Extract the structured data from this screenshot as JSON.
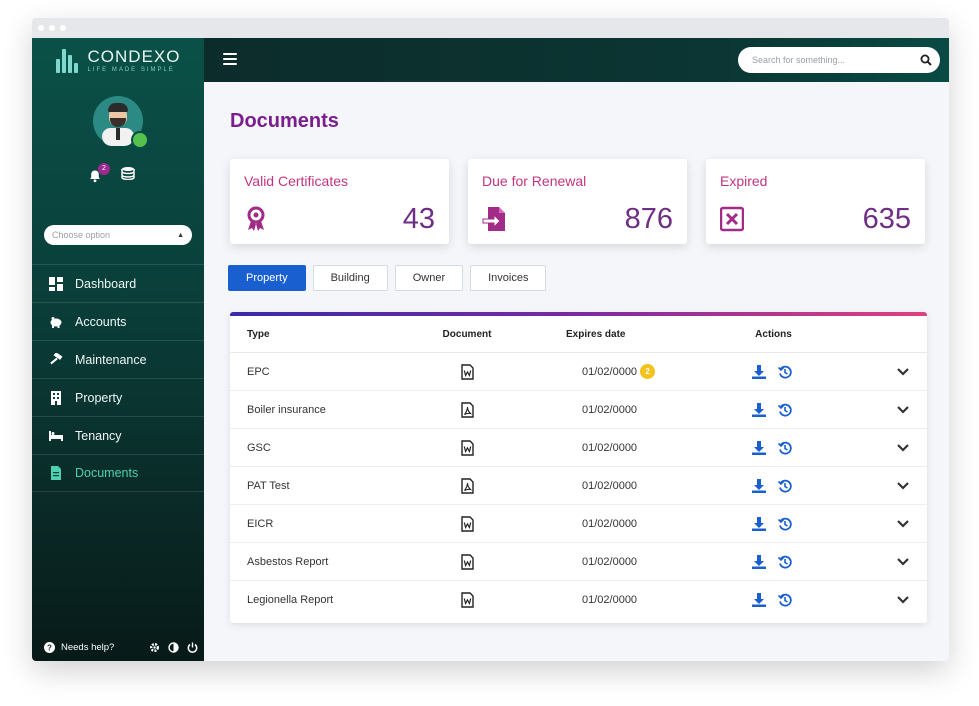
{
  "brand": {
    "name": "CONDEXO",
    "tagline": "LIFE MADE SIMPLE",
    "accent": "#7a1e8e",
    "card_label_color": "#c3347f",
    "active_tab_color": "#1a5fd0",
    "active_nav_color": "#4fd0b0"
  },
  "sidebar": {
    "notification_count": "2",
    "choose_option": "Choose option",
    "items": [
      {
        "label": "Dashboard",
        "icon": "dashboard-icon"
      },
      {
        "label": "Accounts",
        "icon": "piggy-bank-icon"
      },
      {
        "label": "Maintenance",
        "icon": "hammer-icon"
      },
      {
        "label": "Property",
        "icon": "building-icon"
      },
      {
        "label": "Tenancy",
        "icon": "bed-icon"
      },
      {
        "label": "Documents",
        "icon": "document-icon",
        "active": true
      }
    ],
    "help": "Needs help?"
  },
  "topbar": {
    "search_placeholder": "Search for something..."
  },
  "page": {
    "title": "Documents"
  },
  "cards": [
    {
      "label": "Valid Certificates",
      "value": "43",
      "icon": "award-icon"
    },
    {
      "label": "Due for Renewal",
      "value": "876",
      "icon": "file-import-icon"
    },
    {
      "label": "Expired",
      "value": "635",
      "icon": "expired-x-icon"
    }
  ],
  "tabs": [
    {
      "label": "Property",
      "active": true
    },
    {
      "label": "Building"
    },
    {
      "label": "Owner"
    },
    {
      "label": "Invoices"
    }
  ],
  "table": {
    "headers": {
      "type": "Type",
      "document": "Document",
      "expires": "Expires date",
      "actions": "Actions"
    },
    "rows": [
      {
        "type": "EPC",
        "doc_icon": "word-file-icon",
        "expires": "01/02/0000",
        "badge": "2"
      },
      {
        "type": "Boiler insurance",
        "doc_icon": "pdf-file-icon",
        "expires": "01/02/0000"
      },
      {
        "type": "GSC",
        "doc_icon": "word-file-icon",
        "expires": "01/02/0000"
      },
      {
        "type": "PAT Test",
        "doc_icon": "pdf-file-icon",
        "expires": "01/02/0000"
      },
      {
        "type": "EICR",
        "doc_icon": "word-file-icon",
        "expires": "01/02/0000"
      },
      {
        "type": "Asbestos Report",
        "doc_icon": "word-file-icon",
        "expires": "01/02/0000"
      },
      {
        "type": "Legionella Report",
        "doc_icon": "word-file-icon",
        "expires": "01/02/0000"
      }
    ]
  }
}
